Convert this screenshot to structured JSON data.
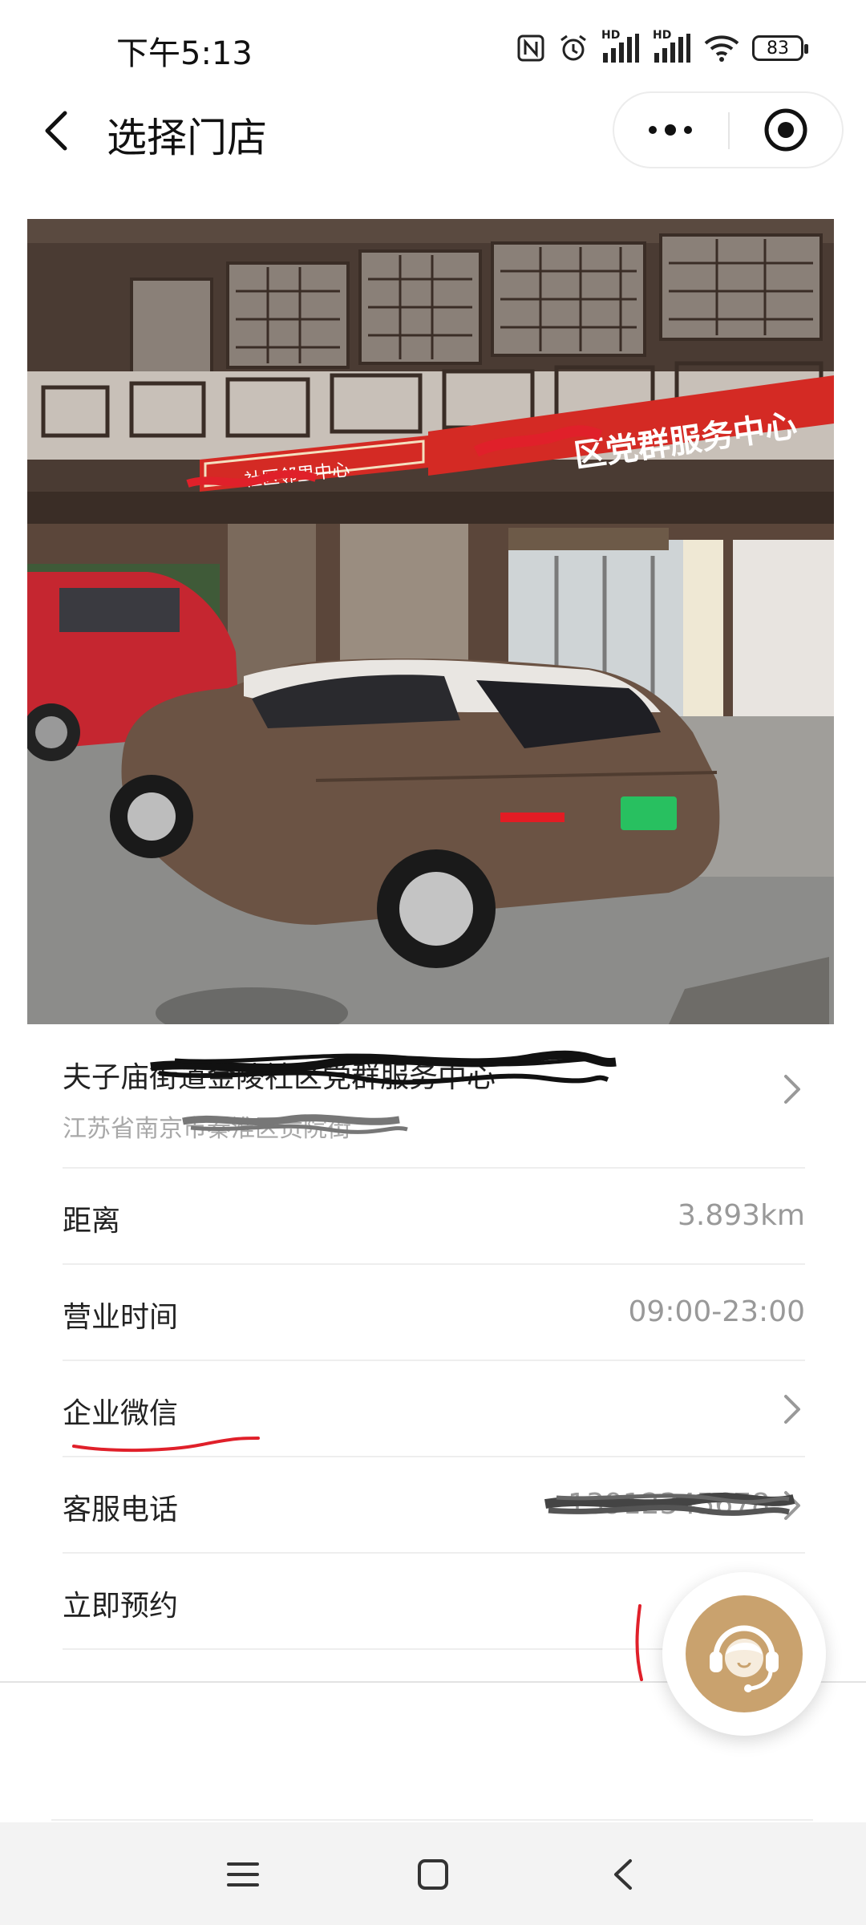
{
  "status_bar": {
    "time": "下午5:13",
    "battery": "83",
    "signal_1_label": "HD",
    "signal_2_label": "HD"
  },
  "nav": {
    "title": "选择门店"
  },
  "store": {
    "name": "夫子庙街道金陵社区党群服务中心",
    "address": "江苏省南京市秦淮区贡院街"
  },
  "photo": {
    "sign_right": "区党群服务中心",
    "sign_left": "社区邻里中心"
  },
  "rows": [
    {
      "label": "距离",
      "value": "3.893km"
    },
    {
      "label": "营业时间",
      "value": "09:00-23:00"
    },
    {
      "label": "企业微信",
      "value": ""
    },
    {
      "label": "客服电话",
      "value": "13912345678"
    },
    {
      "label": "立即预约",
      "value": ""
    }
  ],
  "colors": {
    "accent_gold": "#c9a26e",
    "value_gray": "#999999",
    "annotation_red": "#e0202a"
  }
}
